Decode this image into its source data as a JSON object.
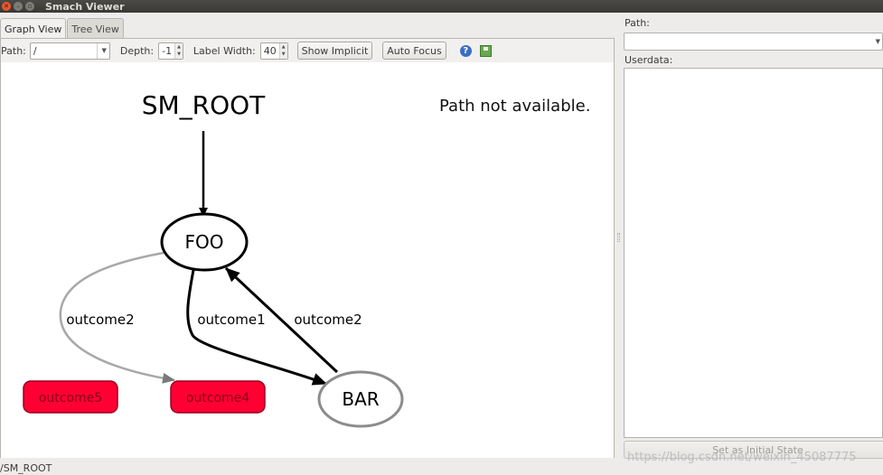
{
  "window": {
    "title": "Smach Viewer"
  },
  "tabs": [
    {
      "label": "Graph View",
      "active": true
    },
    {
      "label": "Tree View",
      "active": false
    }
  ],
  "toolbar": {
    "path_label": "Path:",
    "path_value": "/",
    "depth_label": "Depth:",
    "depth_value": "-1",
    "label_width_label": "Label Width:",
    "label_width_value": "40",
    "show_implicit_label": "Show Implicit",
    "auto_focus_label": "Auto Focus",
    "help_icon": "help-icon",
    "save_icon": "save-icon"
  },
  "graph": {
    "container_label": "SM_ROOT",
    "path_message": "Path not available.",
    "nodes": [
      {
        "id": "foo",
        "label": "FOO",
        "kind": "state"
      },
      {
        "id": "bar",
        "label": "BAR",
        "kind": "state"
      },
      {
        "id": "outcome5",
        "label": "outcome5",
        "kind": "outcome"
      },
      {
        "id": "outcome4",
        "label": "outcome4",
        "kind": "outcome"
      }
    ],
    "edges": [
      {
        "from": "SM_ROOT",
        "to": "foo",
        "label": ""
      },
      {
        "from": "foo",
        "to": "outcome4",
        "label": "outcome2"
      },
      {
        "from": "foo",
        "to": "bar",
        "label": "outcome1"
      },
      {
        "from": "bar",
        "to": "foo",
        "label": "outcome2"
      }
    ],
    "colors": {
      "outcome_fill": "#ff0033",
      "outcome_border": "#9a0020",
      "active_edge": "#000000",
      "inactive_edge": "#a8a8a8",
      "inactive_node_border": "#8c8c8c"
    }
  },
  "right_panel": {
    "path_label": "Path:",
    "path_value": "",
    "userdata_label": "Userdata:",
    "set_initial_state_label": "Set as Initial State"
  },
  "status_bar": {
    "text": "/SM_ROOT"
  },
  "watermark": {
    "text": "https://blog.csdn.net/weixin_45087775"
  }
}
